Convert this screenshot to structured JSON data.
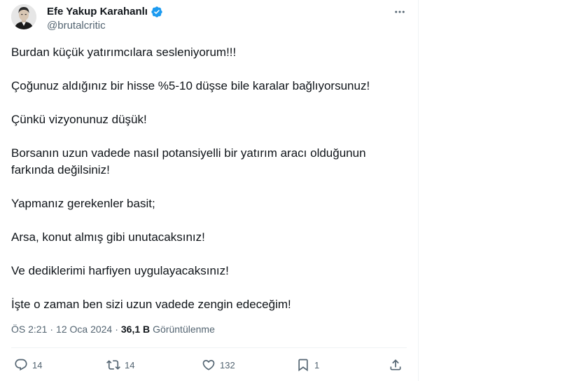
{
  "author": {
    "display_name": "Efe Yakup Karahanlı",
    "handle": "@brutalcritic",
    "verified": true,
    "verified_color": "#1d9bf0"
  },
  "tweet": {
    "paragraphs": [
      "Burdan küçük yatırımcılara sesleniyorum!!!",
      "Çoğunuz aldığınız bir hisse %5-10 düşse bile karalar bağlıyorsunuz!",
      "Çünkü vizyonunuz düşük!",
      "Borsanın uzun vadede nasıl potansiyelli bir yatırım aracı olduğunun\nfarkında değilsiniz!",
      "Yapmanız gerekenler basit;",
      "Arsa, konut almış gibi unutacaksınız!",
      "Ve dediklerimi harfiyen uygulayacaksınız!",
      "İşte o zaman ben sizi uzun vadede zengin edeceğim!"
    ]
  },
  "meta": {
    "time": "ÖS 2:21",
    "separator": "·",
    "date": "12 Oca 2024",
    "separator2": "·",
    "views_count": "36,1 B",
    "views_label": "Görüntülenme"
  },
  "actions": {
    "replies": "14",
    "retweets": "14",
    "likes": "132",
    "bookmarks": "1"
  },
  "icons": {
    "more": "more-horizontal-icon",
    "reply": "reply-icon",
    "retweet": "retweet-icon",
    "like": "heart-icon",
    "bookmark": "bookmark-icon",
    "share": "share-icon",
    "verified": "verified-badge-icon"
  },
  "colors": {
    "text_primary": "#0f1419",
    "text_secondary": "#536471",
    "divider": "#eff3f4"
  }
}
